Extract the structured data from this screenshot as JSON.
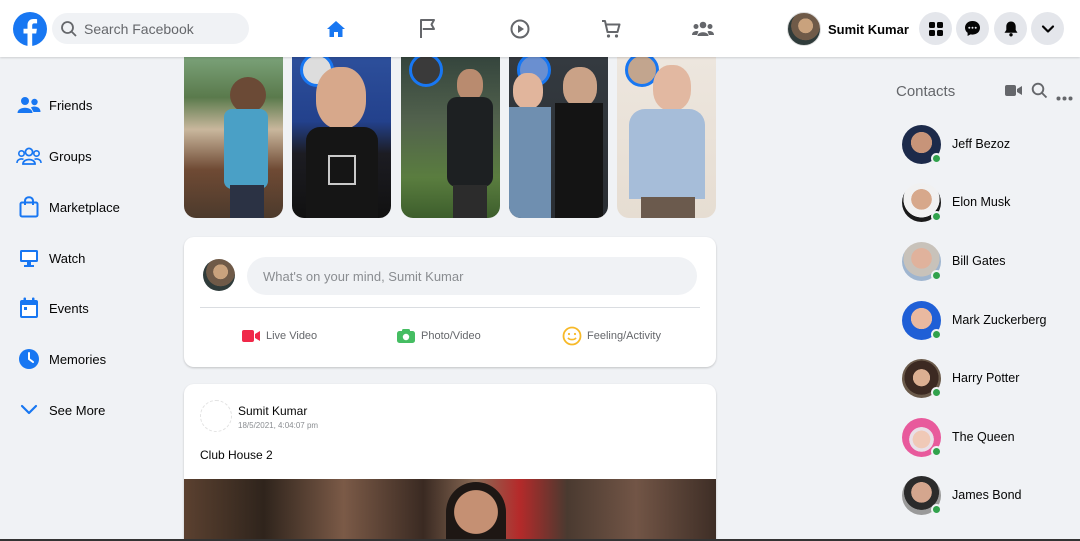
{
  "header": {
    "search_placeholder": "Search Facebook",
    "profile_name": "Sumit Kumar",
    "nav": [
      "home-icon",
      "flag-icon",
      "watch-icon",
      "marketplace-icon",
      "groups-icon"
    ],
    "active_color": "#1877f2"
  },
  "sidebar": {
    "items": [
      {
        "label": "Friends",
        "icon": "friends-icon"
      },
      {
        "label": "Groups",
        "icon": "groups-icon"
      },
      {
        "label": "Marketplace",
        "icon": "marketplace-icon"
      },
      {
        "label": "Watch",
        "icon": "watch-icon"
      },
      {
        "label": "Events",
        "icon": "events-icon"
      },
      {
        "label": "Memories",
        "icon": "memories-icon"
      },
      {
        "label": "See More",
        "icon": "chevron-down-icon"
      }
    ]
  },
  "composer": {
    "placeholder": "What's on your mind, Sumit Kumar",
    "actions": [
      {
        "label": "Live Video",
        "icon": "live-video-icon",
        "color": "#f02849"
      },
      {
        "label": "Photo/Video",
        "icon": "photo-icon",
        "color": "#45bd62"
      },
      {
        "label": "Feeling/Activity",
        "icon": "feeling-icon",
        "color": "#f7b928"
      }
    ]
  },
  "post": {
    "author": "Sumit Kumar",
    "timestamp": "18/5/2021, 4:04:07 pm",
    "text": "Club House 2"
  },
  "contacts": {
    "title": "Contacts",
    "people": [
      "Jeff Bezoz",
      "Elon Musk",
      "Bill Gates",
      "Mark Zuckerberg",
      "Harry Potter",
      "The Queen",
      "James Bond"
    ]
  }
}
